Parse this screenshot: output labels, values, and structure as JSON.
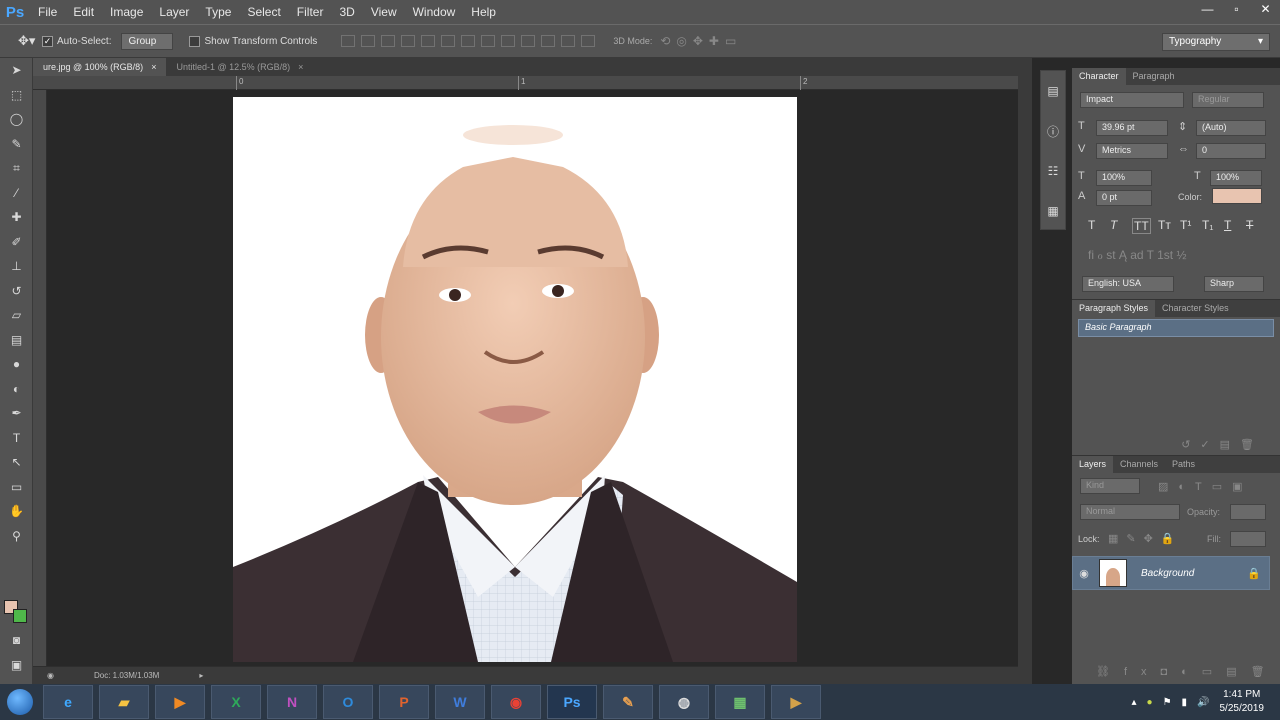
{
  "app": {
    "logo": "Ps"
  },
  "menu": [
    "File",
    "Edit",
    "Image",
    "Layer",
    "Type",
    "Select",
    "Filter",
    "3D",
    "View",
    "Window",
    "Help"
  ],
  "window_controls": [
    "—",
    "▫",
    "✕"
  ],
  "options": {
    "auto_select_label": "Auto-Select:",
    "auto_select_value": "Group",
    "show_transform_label": "Show Transform Controls",
    "mode_3d_label": "3D Mode:",
    "workspace": "Typography"
  },
  "tabs": [
    {
      "label": "ure.jpg @ 100% (RGB/8)",
      "close": "×"
    },
    {
      "label": "Untitled-1 @ 12.5% (RGB/8)",
      "close": "×"
    }
  ],
  "ruler": {
    "marks": [
      "0",
      "1",
      "2"
    ]
  },
  "status": {
    "doc": "Doc: 1.03M/1.03M"
  },
  "character": {
    "tabs": [
      "Character",
      "Paragraph"
    ],
    "font_family": "Impact",
    "font_style": "Regular",
    "size": "39.96 pt",
    "leading": "(Auto)",
    "kerning": "Metrics",
    "tracking": "0",
    "vscale": "100%",
    "hscale": "100%",
    "baseline": "0 pt",
    "color_label": "Color:",
    "color": "#e8c4b0",
    "language": "English: USA",
    "antialias": "Sharp"
  },
  "paragraph_styles": {
    "tabs": [
      "Paragraph Styles",
      "Character Styles"
    ],
    "items": [
      "Basic Paragraph"
    ]
  },
  "layers": {
    "tabs": [
      "Layers",
      "Channels",
      "Paths"
    ],
    "filter": "Kind",
    "blend_mode": "Normal",
    "opacity_label": "Opacity:",
    "lock_label": "Lock:",
    "fill_label": "Fill:",
    "items": [
      {
        "name": "Background"
      }
    ]
  },
  "taskbar": {
    "apps": [
      "IE",
      "Files",
      "Media",
      "Excel",
      "OneNote",
      "Outlook",
      "PowerPoint",
      "Word",
      "Chrome",
      "Photoshop",
      "Paint",
      "OBS",
      "Network",
      "Video"
    ],
    "time": "1:41 PM",
    "date": "5/25/2019"
  }
}
